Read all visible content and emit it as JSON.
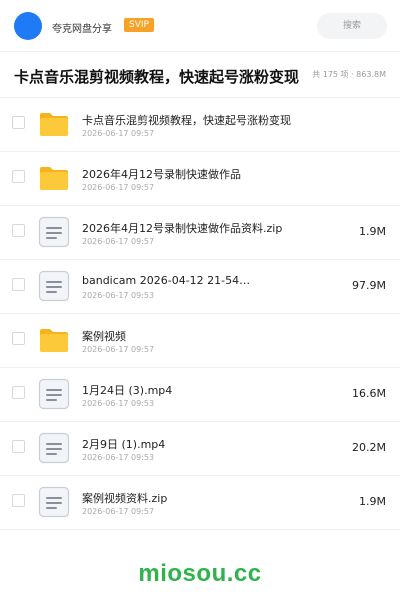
{
  "header": {
    "app_name": "夸克网盘分享",
    "badge": "SVIP",
    "search_placeholder": "搜索"
  },
  "share": {
    "title": "卡点音乐混剪视频教程，快速起号涨粉变现",
    "summary": "共 175 项 · 863.8M"
  },
  "files": [
    {
      "name": "卡点音乐混剪视频教程，快速起号涨粉变现",
      "date": "2026-06-17 09:57",
      "size": "",
      "type": "folder"
    },
    {
      "name": "2026年4月12号录制快速做作品",
      "date": "2026-06-17 09:57",
      "size": "",
      "type": "folder"
    },
    {
      "name": "2026年4月12号录制快速做作品资料.zip",
      "date": "2026-06-17 09:57",
      "size": "1.9M",
      "type": "file"
    },
    {
      "name": "bandicam 2026-04-12 21-54…",
      "date": "2026-06-17 09:53",
      "size": "97.9M",
      "type": "file"
    },
    {
      "name": "案例视频",
      "date": "2026-06-17 09:57",
      "size": "",
      "type": "folder"
    },
    {
      "name": "1月24日 (3).mp4",
      "date": "2026-06-17 09:53",
      "size": "16.6M",
      "type": "file"
    },
    {
      "name": "2月9日 (1).mp4",
      "date": "2026-06-17 09:53",
      "size": "20.2M",
      "type": "file"
    },
    {
      "name": "案例视频资料.zip",
      "date": "2026-06-17 09:57",
      "size": "1.9M",
      "type": "file"
    }
  ],
  "watermark": "miosou.cc",
  "colors": {
    "accent": "#1e7bf5",
    "svip": "#f7a226",
    "folder": "#fbc531",
    "watermark": "#2fb34a"
  },
  "icons": {
    "folder": "folder-icon",
    "file": "document-icon"
  }
}
